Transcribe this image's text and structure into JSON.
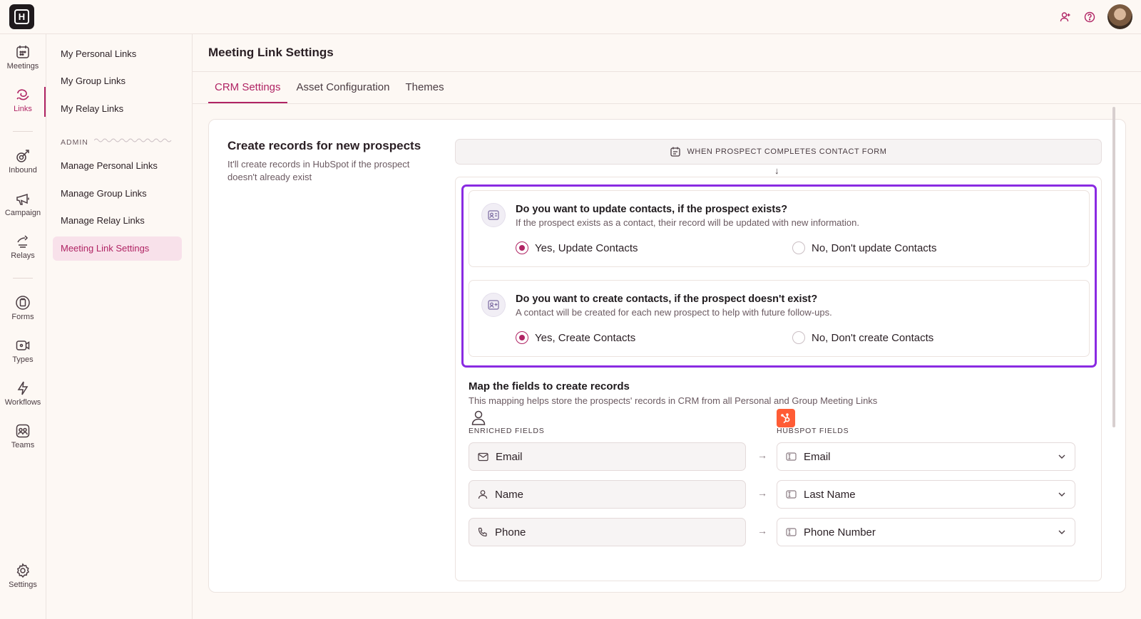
{
  "app": {
    "logo_letter": "H",
    "title": "Meeting Link Settings"
  },
  "rail": {
    "items": [
      {
        "label": "Meetings",
        "icon": "calendar-icon"
      },
      {
        "label": "Links",
        "icon": "link-loop-icon",
        "active": true
      },
      {
        "label": "Inbound",
        "icon": "inbound-icon"
      },
      {
        "label": "Campaign",
        "icon": "megaphone-icon"
      },
      {
        "label": "Relays",
        "icon": "relay-icon"
      },
      {
        "label": "Forms",
        "icon": "form-icon"
      },
      {
        "label": "Types",
        "icon": "video-icon"
      },
      {
        "label": "Workflows",
        "icon": "bolt-icon"
      },
      {
        "label": "Teams",
        "icon": "team-icon"
      },
      {
        "label": "Settings",
        "icon": "gear-icon"
      }
    ]
  },
  "subnav": {
    "items": [
      "My Personal Links",
      "My Group Links",
      "My Relay Links"
    ],
    "admin_label": "ADMIN",
    "admin_items": [
      "Manage Personal Links",
      "Manage Group Links",
      "Manage Relay Links",
      "Meeting Link Settings"
    ]
  },
  "tabs": [
    "CRM Settings",
    "Asset Configuration",
    "Themes"
  ],
  "card": {
    "title": "Create records for new prospects",
    "description": "It'll create records in HubSpot if the prospect doesn't already exist",
    "trigger": "WHEN PROSPECT COMPLETES CONTACT FORM",
    "arrow": "↓"
  },
  "questions": [
    {
      "title": "Do you want to update contacts, if the prospect exists?",
      "subtitle": "If the prospect exists as a contact, their record will be updated with new information.",
      "yes": "Yes, Update Contacts",
      "no": "No, Don't update Contacts",
      "selected": "yes"
    },
    {
      "title": "Do you want to create contacts, if the prospect doesn't exist?",
      "subtitle": "A contact will be created for each new prospect to help with future follow-ups.",
      "yes": "Yes, Create Contacts",
      "no": "No, Don't create Contacts",
      "selected": "yes"
    }
  ],
  "mapping": {
    "title": "Map the fields to create records",
    "subtitle": "This mapping helps store the prospects' records in CRM from all Personal and Group Meeting Links",
    "left_header": "ENRICHED FIELDS",
    "right_header": "HUBSPOT FIELDS",
    "arrow": "→",
    "rows": [
      {
        "left": "Email",
        "left_icon": "mail-icon",
        "right": "Email"
      },
      {
        "left": "Name",
        "left_icon": "person-icon",
        "right": "Last Name"
      },
      {
        "left": "Phone",
        "left_icon": "phone-icon",
        "right": "Phone Number"
      }
    ]
  },
  "colors": {
    "accent": "#b02464",
    "highlight": "#8a2be2",
    "hubspot": "#ff5c35"
  }
}
